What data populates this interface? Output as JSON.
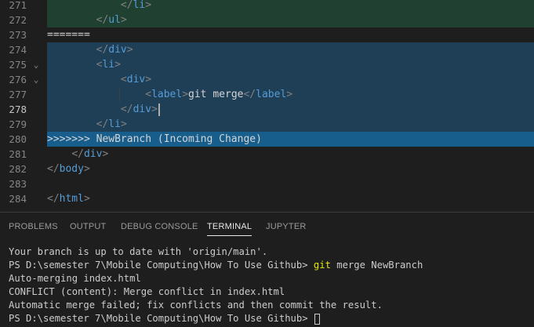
{
  "editor": {
    "lines": [
      {
        "num": "271",
        "fold": "",
        "indent": "            ",
        "open": "</",
        "tag": "li",
        "close": ">",
        "text": "",
        "trail": ""
      },
      {
        "num": "272",
        "fold": "",
        "indent": "        ",
        "open": "</",
        "tag": "ul",
        "close": ">",
        "text": "",
        "trail": ""
      },
      {
        "num": "273",
        "marker": "======="
      },
      {
        "num": "274",
        "fold": "",
        "indent": "        ",
        "open": "</",
        "tag": "div",
        "close": ">",
        "text": "",
        "trail": ""
      },
      {
        "num": "275",
        "fold": "⌄",
        "indent": "        ",
        "open": "<",
        "tag": "li",
        "close": ">",
        "text": "",
        "trail": ""
      },
      {
        "num": "276",
        "fold": "⌄",
        "indent": "            ",
        "open": "<",
        "tag": "div",
        "close": ">",
        "text": "",
        "trail": ""
      },
      {
        "num": "277",
        "fold": "",
        "indent": "                ",
        "open": "<",
        "tag": "label",
        "close": ">",
        "text": "git merge",
        "trail_open": "</",
        "trail_tag": "label",
        "trail_close": ">"
      },
      {
        "num": "278",
        "fold": "",
        "indent": "            ",
        "open": "</",
        "tag": "div",
        "close": ">",
        "text": "",
        "trail": ""
      },
      {
        "num": "279",
        "fold": "",
        "indent": "        ",
        "open": "</",
        "tag": "li",
        "close": ">",
        "text": "",
        "trail": ""
      },
      {
        "num": "280",
        "marker": ">>>>>>> NewBranch (Incoming Change)"
      },
      {
        "num": "281",
        "fold": "",
        "indent": "    ",
        "open": "</",
        "tag": "div",
        "close": ">",
        "text": "",
        "trail": ""
      },
      {
        "num": "282",
        "fold": "",
        "indent": "",
        "open": "</",
        "tag": "body",
        "close": ">",
        "text": "",
        "trail": ""
      },
      {
        "num": "283",
        "fold": "",
        "indent": "",
        "open": "",
        "tag": "",
        "close": "",
        "text": "",
        "trail": ""
      },
      {
        "num": "284",
        "fold": "",
        "indent": "",
        "open": "</",
        "tag": "html",
        "close": ">",
        "text": "",
        "trail": ""
      }
    ]
  },
  "panel": {
    "tabs": {
      "problems": "PROBLEMS",
      "output": "OUTPUT",
      "debug_console": "DEBUG CONSOLE",
      "terminal": "TERMINAL",
      "jupyter": "JUPYTER"
    },
    "terminal": {
      "line1": "Your branch is up to date with 'origin/main'.",
      "prompt1": "PS D:\\semester 7\\Mobile Computing\\How To Use Github> ",
      "cmd_git": "git",
      "cmd_rest": " merge NewBranch",
      "line3": "Auto-merging index.html",
      "line4": "CONFLICT (content): Merge conflict in index.html",
      "line5": "Automatic merge failed; fix conflicts and then commit the result.",
      "prompt2": "PS D:\\semester 7\\Mobile Computing\\How To Use Github> "
    }
  },
  "colors": {
    "current_change_bg": "#204032",
    "incoming_change_bg": "#1f3f57",
    "incoming_header_bg": "#175e8c",
    "tag": "#569cd6",
    "git_command": "#e5e510"
  }
}
